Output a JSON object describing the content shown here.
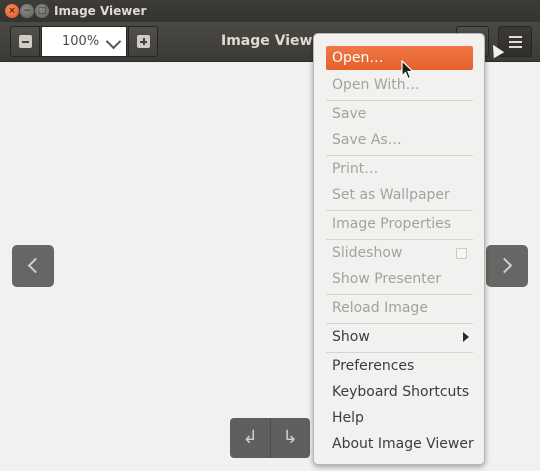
{
  "window": {
    "title": "Image Viewer",
    "close_glyph": "×",
    "min_glyph": "−",
    "max_glyph": "□"
  },
  "header": {
    "app_title": "Image Viewer",
    "zoom_value": "100%"
  },
  "rotate": {
    "left_glyph": "↲",
    "right_glyph": "↳"
  },
  "menu": {
    "items": [
      {
        "label": "Open…",
        "state": "active"
      },
      {
        "label": "Open With…",
        "state": "disabled"
      },
      {
        "label": "Save",
        "state": "disabled"
      },
      {
        "label": "Save As…",
        "state": "disabled"
      },
      {
        "label": "Print…",
        "state": "disabled"
      },
      {
        "label": "Set as Wallpaper",
        "state": "disabled"
      },
      {
        "label": "Image Properties",
        "state": "disabled"
      },
      {
        "label": "Slideshow",
        "state": "disabled"
      },
      {
        "label": "Show Presenter",
        "state": "disabled"
      },
      {
        "label": "Reload Image",
        "state": "disabled"
      },
      {
        "label": "Show",
        "state": "enabled"
      },
      {
        "label": "Preferences",
        "state": "enabled"
      },
      {
        "label": "Keyboard Shortcuts",
        "state": "enabled"
      },
      {
        "label": "Help",
        "state": "enabled"
      },
      {
        "label": "About Image Viewer",
        "state": "enabled"
      }
    ]
  },
  "colors": {
    "accent": "#e86332",
    "background": "#f2f1f0",
    "headerbar": "#3f3e3a"
  }
}
